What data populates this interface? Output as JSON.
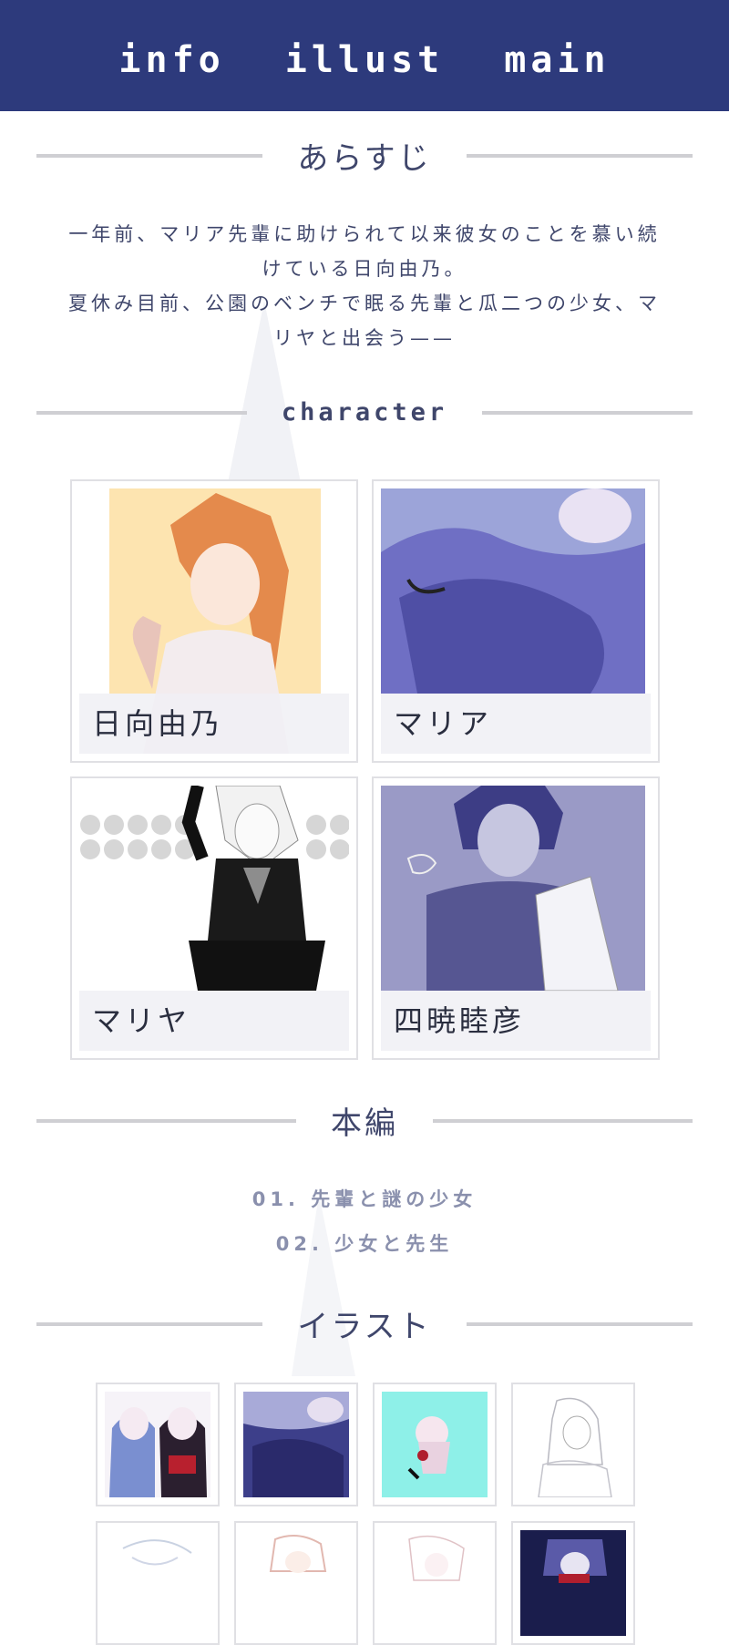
{
  "nav": {
    "items": [
      "info",
      "illust",
      "main"
    ]
  },
  "synopsis": {
    "heading": "あらすじ",
    "lines": [
      "一年前、マリア先輩に助けられて以来彼女のことを慕い続",
      "けている日向由乃。",
      "夏休み目前、公園のベンチで眠る先輩と瓜二つの少女、マ",
      "リヤと出会う——"
    ]
  },
  "character": {
    "heading": "character",
    "cards": [
      {
        "name": "日向由乃"
      },
      {
        "name": "マリア"
      },
      {
        "name": "マリヤ"
      },
      {
        "name": "四暁睦彦"
      }
    ]
  },
  "main": {
    "heading": "本編",
    "chapters": [
      "01. 先輩と謎の少女",
      "02. 少女と先生"
    ]
  },
  "illust": {
    "heading": "イラスト"
  },
  "colors": {
    "nav_bg": "#2d3a7c",
    "text": "#3f466b",
    "muted": "#8a90ad",
    "line": "#cfcfd3"
  }
}
